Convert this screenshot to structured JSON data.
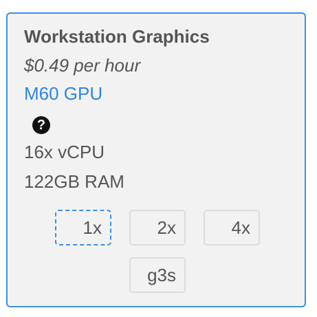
{
  "card": {
    "title": "Workstation Graphics",
    "price": "$0.49 per hour",
    "gpu_link": "M60 GPU",
    "help_icon": "?",
    "specs": {
      "cpu": "16x vCPU",
      "ram": "122GB RAM"
    },
    "options": [
      {
        "label": "1x",
        "selected": true
      },
      {
        "label": "2x",
        "selected": false
      },
      {
        "label": "4x",
        "selected": false
      },
      {
        "label": "g3s",
        "selected": false
      }
    ]
  },
  "colors": {
    "accent": "#3d8ee6",
    "link": "#2f86e0",
    "text": "#555555",
    "card_background": "#f2f2f2"
  }
}
